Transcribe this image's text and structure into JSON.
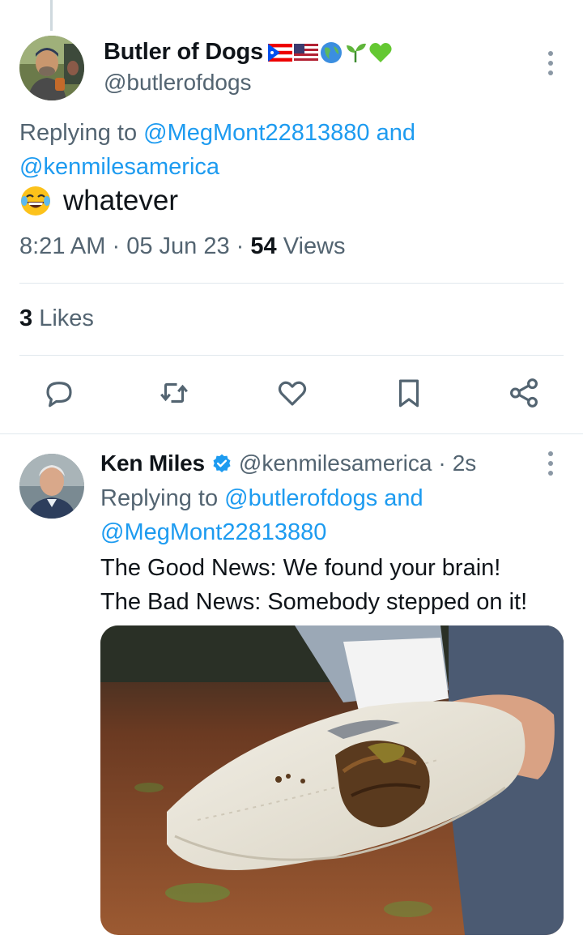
{
  "main_tweet": {
    "author": {
      "display_name": "Butler of Dogs",
      "name_emojis": [
        "puerto-rico-flag",
        "us-flag",
        "earth-globe",
        "seedling",
        "green-heart"
      ],
      "handle": "@butlerofdogs"
    },
    "replying_to_prefix": "Replying to",
    "replying_to_user1": "@MegMont22813880",
    "replying_to_and": "and",
    "replying_to_user2": "@kenmilesamerica",
    "text": "whatever",
    "text_emoji": "laughing-face-with-tears",
    "time": "8:21 AM",
    "date": "05 Jun 23",
    "views_count": "54",
    "views_label": "Views",
    "likes_count": "3",
    "likes_label": "Likes",
    "actions": [
      "reply-icon",
      "retweet-icon",
      "like-icon",
      "bookmark-icon",
      "share-icon"
    ]
  },
  "reply_tweet": {
    "author": {
      "display_name": "Ken Miles",
      "verified": true,
      "handle": "@kenmilesamerica",
      "time_ago": "2s"
    },
    "replying_to_prefix": "Replying to",
    "replying_to_user1": "@butlerofdogs",
    "replying_to_and": "and",
    "replying_to_user2": "@MegMont22813880",
    "text_line1": "The Good News: We found your brain!",
    "text_line2": "The Bad News: Somebody stepped on it!",
    "media": "photo-sneaker-sole-with-mud"
  },
  "colors": {
    "link": "#1d9bf0",
    "secondary_text": "#536471",
    "primary_text": "#0f1419",
    "icon": "#536471",
    "verified": "#1d9bf0"
  }
}
